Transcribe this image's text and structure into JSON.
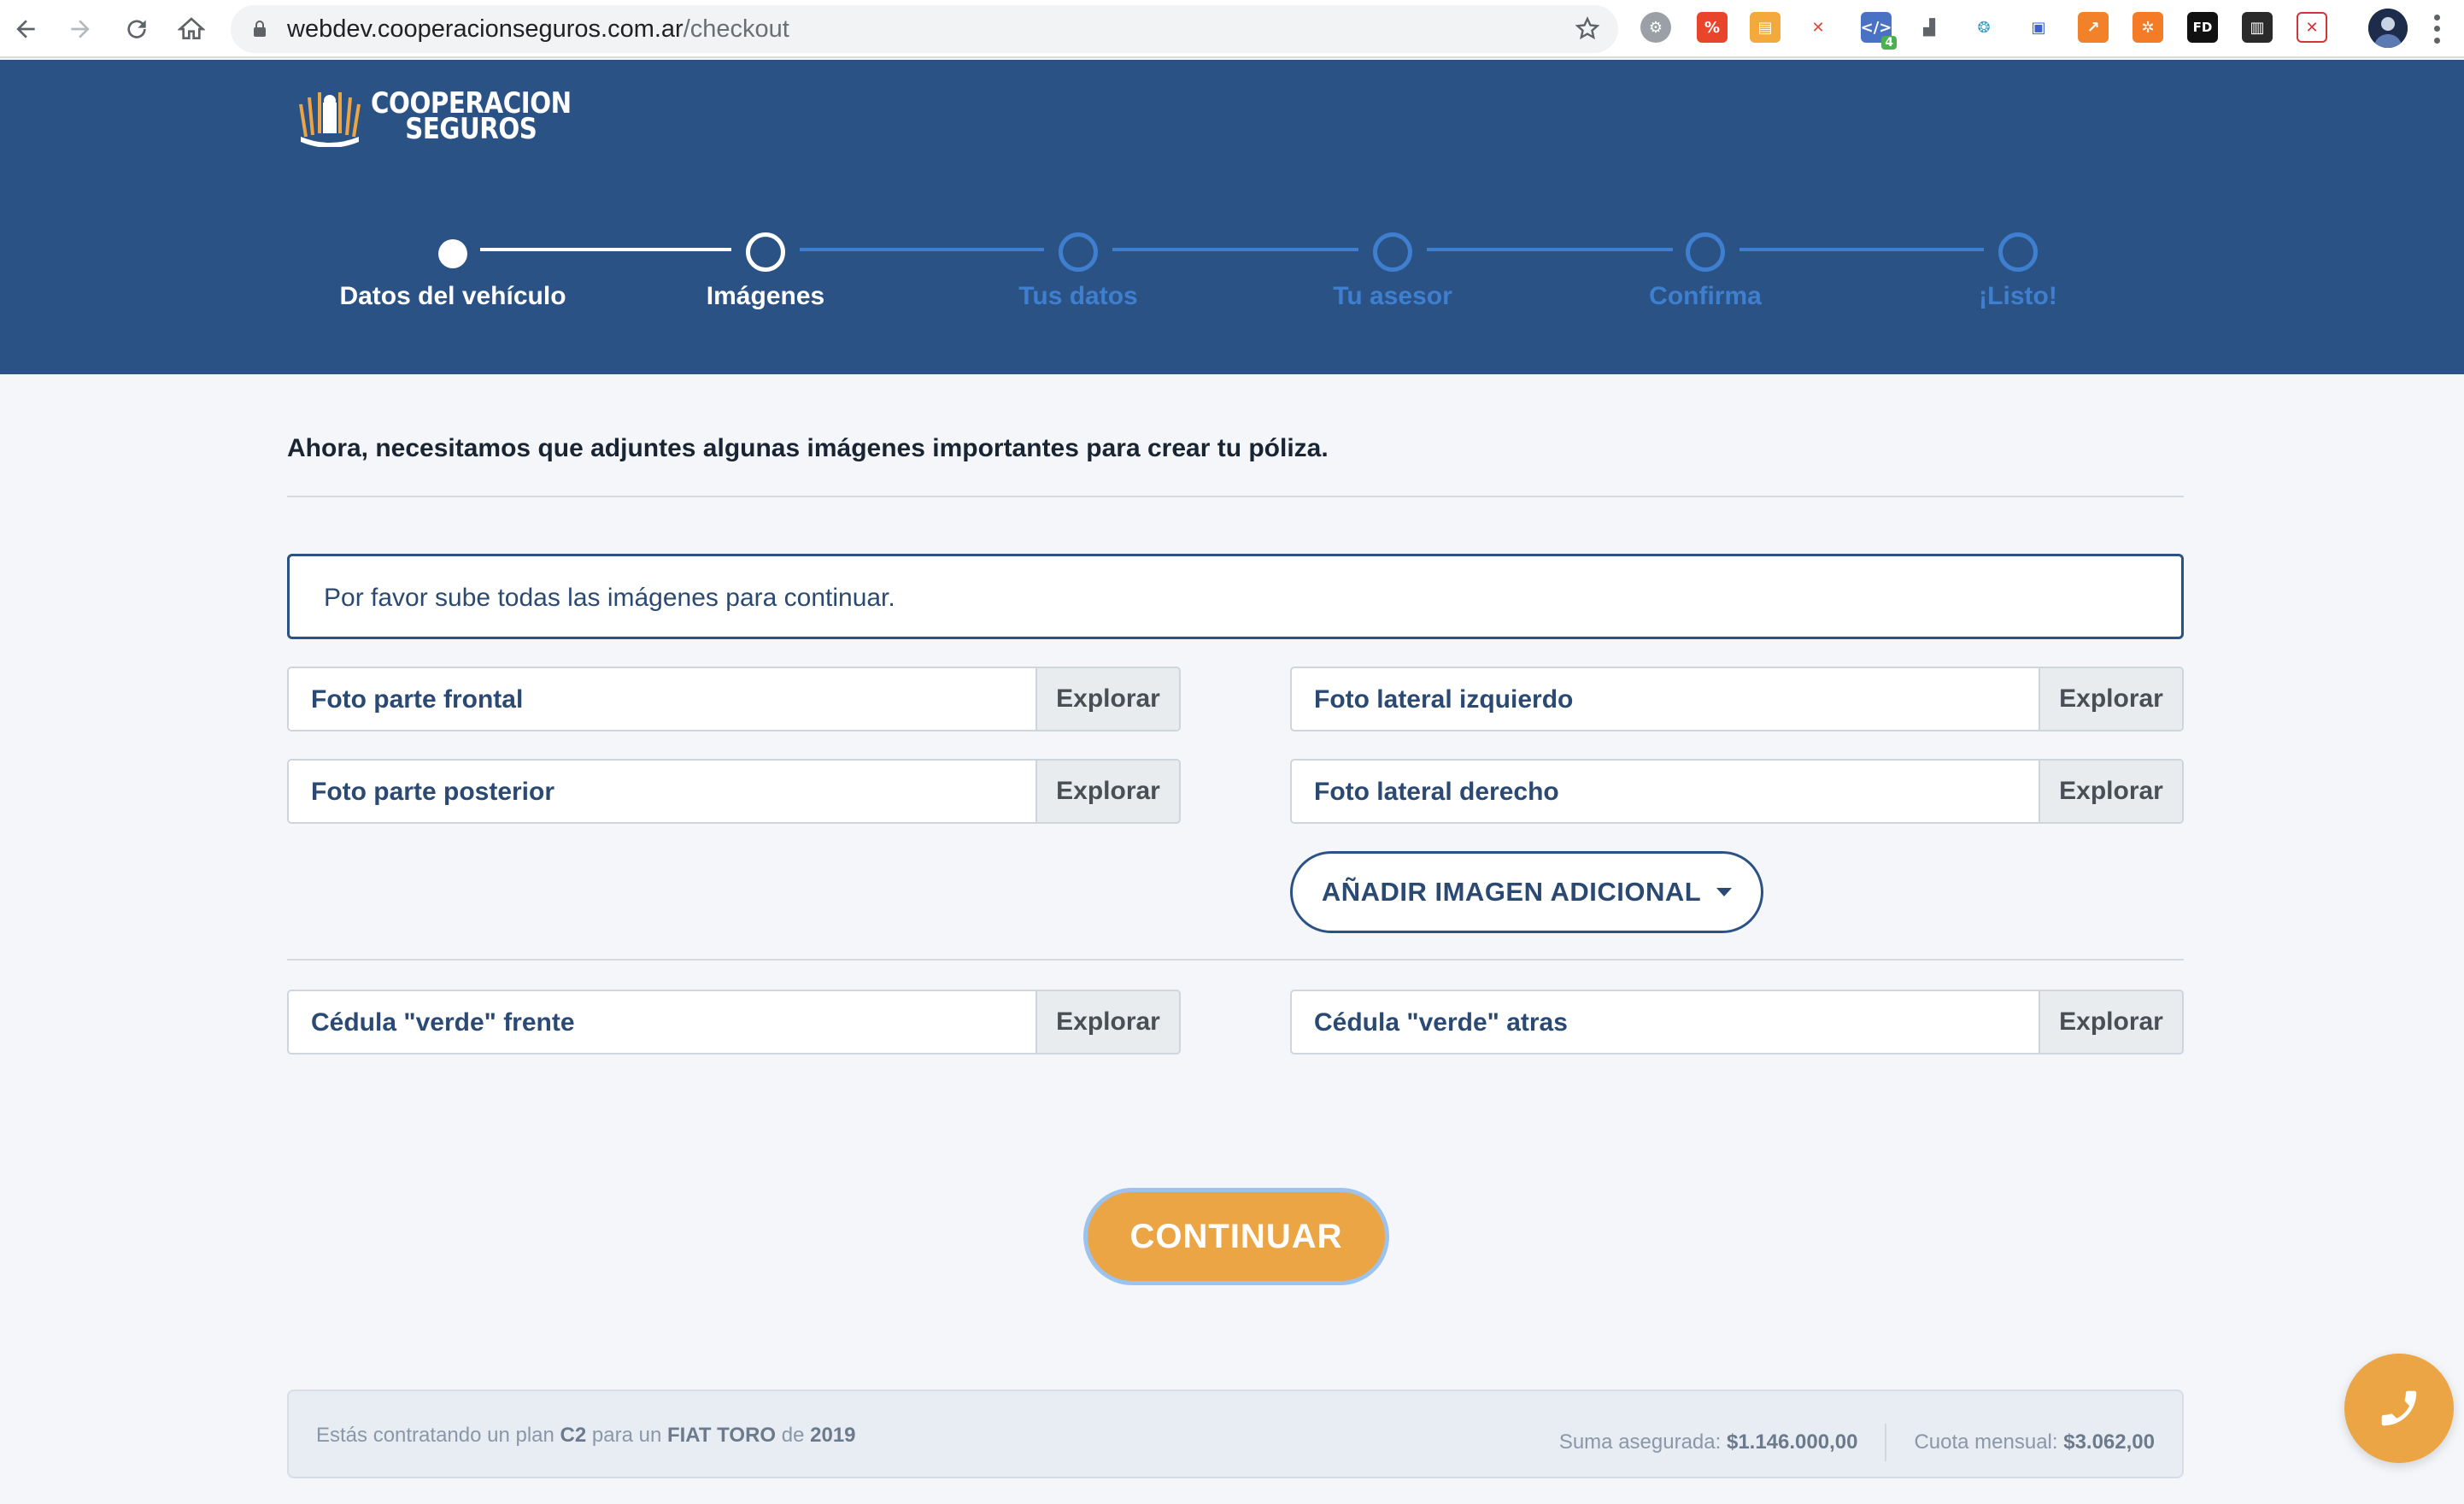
{
  "browser": {
    "url_host": "webdev.cooperacionseguros.com.ar",
    "url_path": "/checkout",
    "extension_badge": "4",
    "extensions": [
      "gear-icon",
      "flag-icon",
      "calendar-icon",
      "grid-icon",
      "code-icon",
      "seo-icon",
      "globe-icon",
      "translate-icon",
      "chart-icon",
      "hubspot-icon",
      "fd-icon",
      "reader-icon",
      "block-icon"
    ]
  },
  "brand": {
    "line1": "COOPERACION",
    "line2": "SEGUROS"
  },
  "stepper": {
    "steps": [
      {
        "label": "Datos del vehículo",
        "state": "done"
      },
      {
        "label": "Imágenes",
        "state": "current"
      },
      {
        "label": "Tus datos",
        "state": "pending"
      },
      {
        "label": "Tu asesor",
        "state": "pending"
      },
      {
        "label": "Confirma",
        "state": "pending"
      },
      {
        "label": "¡Listo!",
        "state": "pending"
      }
    ]
  },
  "main": {
    "intro": "Ahora, necesitamos que adjuntes algunas imágenes importantes para crear tu póliza.",
    "notice": "Por favor sube todas las imágenes para continuar.",
    "uploads": {
      "front": "Foto parte frontal",
      "left": "Foto lateral izquierdo",
      "rear": "Foto parte posterior",
      "right": "Foto lateral derecho",
      "green_front": "Cédula \"verde\" frente",
      "green_back": "Cédula \"verde\" atras"
    },
    "browse_label": "Explorar",
    "add_image_label": "AÑADIR IMAGEN ADICIONAL",
    "continue_label": "CONTINUAR"
  },
  "summary": {
    "prefix": "Estás contratando un plan",
    "plan": "C2",
    "para": "para un",
    "vehicle": "FIAT TORO",
    "de": "de",
    "year": "2019",
    "insured_label": "Suma asegurada:",
    "insured_value": "$1.146.000,00",
    "monthly_label": "Cuota mensual:",
    "monthly_value": "$3.062,00"
  },
  "colors": {
    "header": "#2b5284",
    "accent": "#eca544",
    "pending_step": "#3f7fcf",
    "page": "#f4f6f9"
  }
}
